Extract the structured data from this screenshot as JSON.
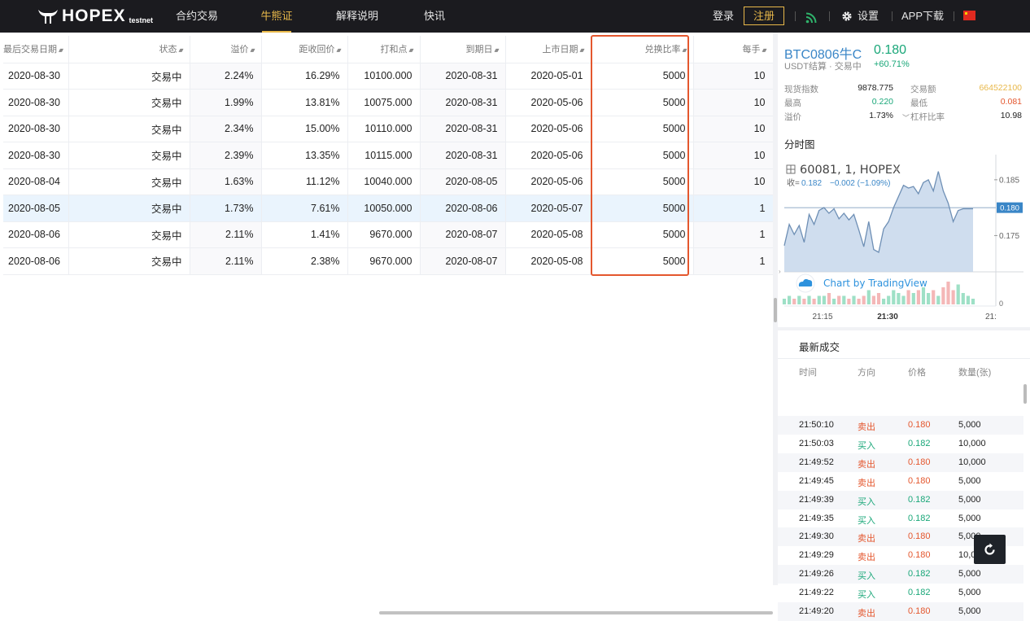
{
  "nav": {
    "logo": "HOPEX",
    "logo_sub": "testnet",
    "items": [
      {
        "label": "合约交易",
        "active": false
      },
      {
        "label": "牛熊证",
        "active": true
      },
      {
        "label": "解释说明",
        "active": false
      },
      {
        "label": "快讯",
        "active": false
      }
    ],
    "login": "登录",
    "register": "注册",
    "settings": "设置",
    "app_download": "APP下载"
  },
  "table": {
    "columns": [
      "最后交易日期",
      "状态",
      "溢价",
      "距收回价",
      "打和点",
      "到期日",
      "上市日期",
      "兑换比率",
      "每手"
    ],
    "rows": [
      [
        "2020-08-30",
        "交易中",
        "2.24%",
        "16.29%",
        "10100.000",
        "2020-08-31",
        "2020-05-01",
        "5000",
        "10"
      ],
      [
        "2020-08-30",
        "交易中",
        "1.99%",
        "13.81%",
        "10075.000",
        "2020-08-31",
        "2020-05-06",
        "5000",
        "10"
      ],
      [
        "2020-08-30",
        "交易中",
        "2.34%",
        "15.00%",
        "10110.000",
        "2020-08-31",
        "2020-05-06",
        "5000",
        "10"
      ],
      [
        "2020-08-30",
        "交易中",
        "2.39%",
        "13.35%",
        "10115.000",
        "2020-08-31",
        "2020-05-06",
        "5000",
        "10"
      ],
      [
        "2020-08-04",
        "交易中",
        "1.63%",
        "11.12%",
        "10040.000",
        "2020-08-05",
        "2020-05-06",
        "5000",
        "10"
      ],
      [
        "2020-08-05",
        "交易中",
        "1.73%",
        "7.61%",
        "10050.000",
        "2020-08-06",
        "2020-05-07",
        "5000",
        "1"
      ],
      [
        "2020-08-06",
        "交易中",
        "2.11%",
        "1.41%",
        "9670.000",
        "2020-08-07",
        "2020-05-08",
        "5000",
        "1"
      ],
      [
        "2020-08-06",
        "交易中",
        "2.11%",
        "2.38%",
        "9670.000",
        "2020-08-07",
        "2020-05-08",
        "5000",
        "1"
      ]
    ],
    "highlighted_row": 5
  },
  "ticker": {
    "name": "BTC0806牛C",
    "price": "0.180",
    "sub": "USDT结算 · 交易中",
    "change": "+60.71%",
    "stats": [
      {
        "label": "现货指数",
        "value": "9878.775",
        "label2": "交易额",
        "value2": "664522100"
      },
      {
        "label": "最高",
        "value": "0.220",
        "label2": "最低",
        "value2": "0.081"
      },
      {
        "label": "溢价",
        "value": "1.73%",
        "label2": "杠杆比率",
        "value2": "10.98"
      }
    ]
  },
  "chart": {
    "section_title": "分时图",
    "symbol": "60081, 1, HOPEX",
    "collect_label": "收=",
    "collect_value": "0.182",
    "collect_change": "−0.002 (−1.09%)",
    "watermark": "Chart by TradingView",
    "current_price_tag": "0.180",
    "y_ticks": [
      "0.185",
      "0.175",
      "0"
    ],
    "x_ticks": [
      "21:15",
      "21:30",
      "21:"
    ]
  },
  "chart_data": {
    "type": "area",
    "x_range": [
      "21:05",
      "21:40"
    ],
    "ylim": [
      0.1685,
      0.1895
    ],
    "y_ticks": [
      0.185,
      0.175
    ],
    "price": [
      0.1732,
      0.177,
      0.1752,
      0.1768,
      0.1738,
      0.1788,
      0.177,
      0.1795,
      0.18,
      0.179,
      0.1798,
      0.178,
      0.179,
      0.1778,
      0.1788,
      0.176,
      0.173,
      0.1775,
      0.1725,
      0.172,
      0.1762,
      0.1775,
      0.18,
      0.182,
      0.184,
      0.1835,
      0.1838,
      0.1825,
      0.1845,
      0.185,
      0.183,
      0.1865,
      0.183,
      0.1808,
      0.1775,
      0.1795,
      0.1798,
      0.1798,
      0.1798
    ],
    "volume": [
      2,
      3,
      2,
      3,
      2,
      3,
      2,
      3,
      3,
      4,
      2,
      3,
      3,
      2,
      3,
      2,
      3,
      5,
      3,
      4,
      2,
      3,
      5,
      4,
      3,
      5,
      4,
      5,
      6,
      4,
      5,
      3,
      6,
      8,
      5,
      7,
      4,
      3,
      2
    ]
  },
  "trades": {
    "title": "最新成交",
    "headers": [
      "时间",
      "方向",
      "价格",
      "数量(张)"
    ],
    "rows": [
      [
        "21:50:10",
        "卖出",
        "0.180",
        "5,000"
      ],
      [
        "21:50:03",
        "买入",
        "0.182",
        "10,000"
      ],
      [
        "21:49:52",
        "卖出",
        "0.180",
        "10,000"
      ],
      [
        "21:49:45",
        "卖出",
        "0.180",
        "5,000"
      ],
      [
        "21:49:39",
        "买入",
        "0.182",
        "5,000"
      ],
      [
        "21:49:35",
        "买入",
        "0.182",
        "5,000"
      ],
      [
        "21:49:30",
        "卖出",
        "0.180",
        "5,000"
      ],
      [
        "21:49:29",
        "卖出",
        "0.180",
        "10,000"
      ],
      [
        "21:49:26",
        "买入",
        "0.182",
        "5,000"
      ],
      [
        "21:49:22",
        "买入",
        "0.182",
        "5,000"
      ],
      [
        "21:49:20",
        "卖出",
        "0.180",
        "5,000"
      ]
    ]
  },
  "colors": {
    "accent": "#e8b84a",
    "buy": "#1aa779",
    "sell": "#e4572e",
    "link": "#3a86c7",
    "highlight_box": "#e4572e"
  }
}
